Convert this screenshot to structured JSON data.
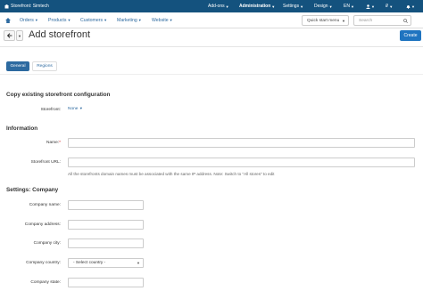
{
  "topbar": {
    "store": "Storefront: Simtech",
    "menus": [
      {
        "label": "Add-ons"
      },
      {
        "label": "Administration"
      },
      {
        "label": "Settings"
      },
      {
        "label": "Design"
      },
      {
        "label": "EN"
      }
    ],
    "currency": "₽"
  },
  "nav": {
    "items": [
      "Orders",
      "Products",
      "Customers",
      "Marketing",
      "Website"
    ],
    "quick_start": "Quick start menu",
    "search_placeholder": "Search"
  },
  "page": {
    "title": "Add storefront",
    "create_label": "Create",
    "tabs": [
      "General",
      "Regions"
    ]
  },
  "copy_section": {
    "title": "Copy existing storefront configuration",
    "storefront_label": "Storefront:",
    "storefront_value": "None"
  },
  "info_section": {
    "title": "Information",
    "name_label": "Name:",
    "url_label": "Storefront URL:",
    "url_hint": "All the storefronts domain names must be associated with the same IP address. Note: Switch to \"All stores\" to edit"
  },
  "company_section": {
    "title": "Settings: Company",
    "fields": {
      "name": "Company name:",
      "address": "Company address:",
      "city": "Company city:",
      "country": "Company country:",
      "state": "Company state:"
    },
    "country_placeholder": "- Select country -"
  }
}
